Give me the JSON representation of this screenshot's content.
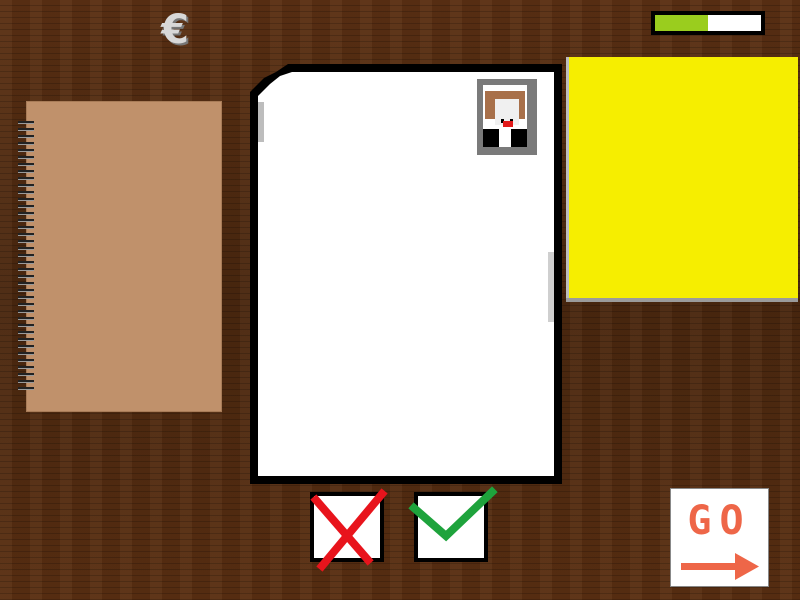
{
  "hud": {
    "currency_symbol": "€",
    "meter_fill_fraction": 0.5,
    "meter_color": "#9acd1e"
  },
  "desk": {
    "notebook_color": "#c0916b",
    "sticky_note_color": "#f6ee00"
  },
  "document": {
    "photo": "applicant-portrait"
  },
  "actions": {
    "reject_icon": "red-cross-icon",
    "approve_icon": "green-check-icon",
    "go_label": "GO",
    "go_icon": "right-arrow-icon",
    "reject_color": "#e8141c",
    "approve_color": "#1ea33c",
    "go_color": "#ee6648"
  }
}
